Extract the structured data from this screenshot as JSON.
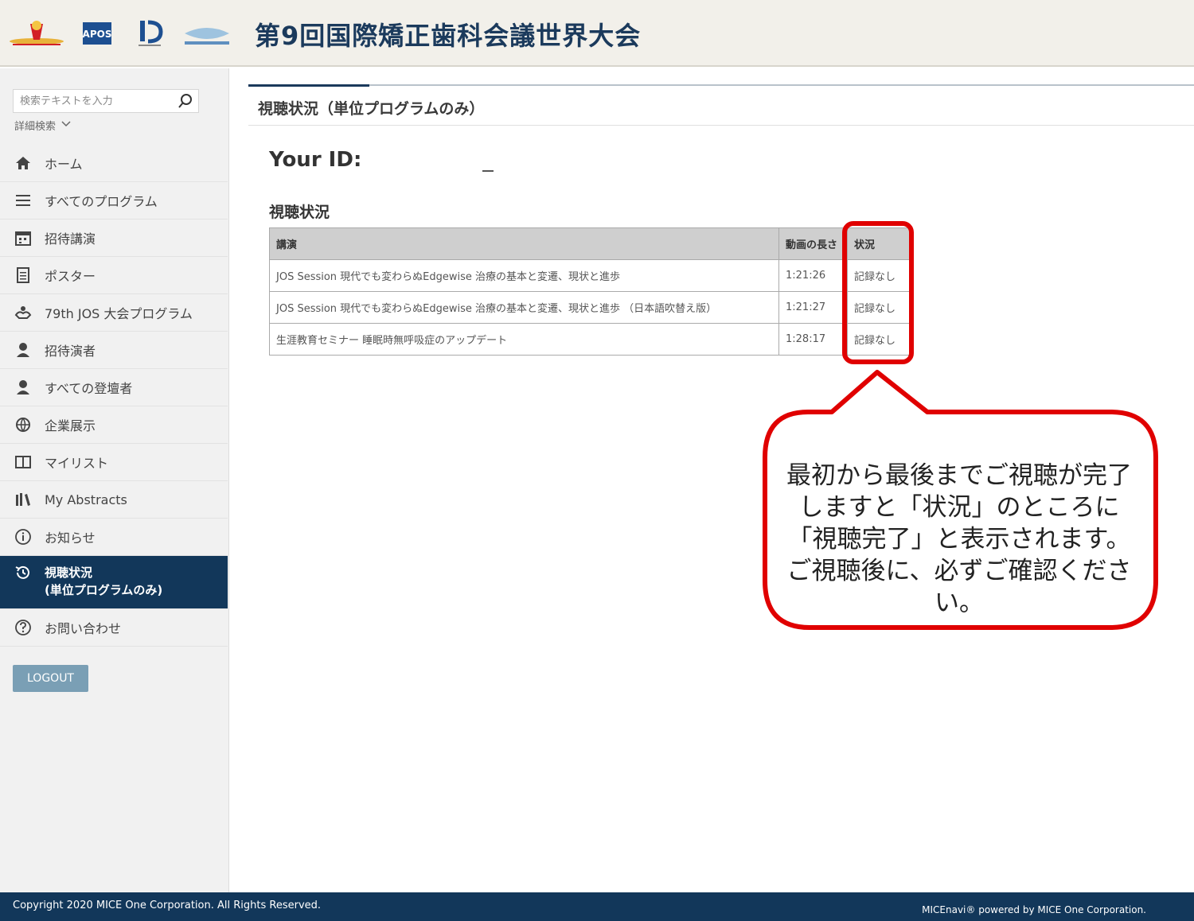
{
  "header": {
    "title": "第9回国際矯正歯科会議世界大会",
    "logos": [
      "congress-logo",
      "apos-logo",
      "ijo-logo",
      "wfo-logo"
    ]
  },
  "sidebar": {
    "search_placeholder": "検索テキストを入力",
    "advanced_search": "詳細検索",
    "items": [
      {
        "label": "ホーム",
        "icon": "home-icon"
      },
      {
        "label": "すべてのプログラム",
        "icon": "list-icon"
      },
      {
        "label": "招待講演",
        "icon": "calendar-icon"
      },
      {
        "label": "ポスター",
        "icon": "document-icon"
      },
      {
        "label": "79th JOS 大会プログラム",
        "icon": "hands-icon"
      },
      {
        "label": "招待演者",
        "icon": "person-icon"
      },
      {
        "label": "すべての登壇者",
        "icon": "person-icon"
      },
      {
        "label": "企業展示",
        "icon": "globe-icon"
      },
      {
        "label": "マイリスト",
        "icon": "book-icon"
      },
      {
        "label": "My Abstracts",
        "icon": "library-icon"
      },
      {
        "label": "お知らせ",
        "icon": "info-icon"
      },
      {
        "label": "視聴状況",
        "label2": "(単位プログラムのみ)",
        "icon": "history-icon",
        "active": true
      },
      {
        "label": "お問い合わせ",
        "icon": "help-icon"
      }
    ],
    "logout": "LOGOUT"
  },
  "main": {
    "page_title": "視聴状況（単位プログラムのみ）",
    "your_id_label": "Your ID:",
    "section_heading": "視聴状況",
    "table": {
      "headers": [
        "講演",
        "動画の長さ",
        "状況"
      ],
      "rows": [
        [
          "JOS Session 現代でも変わらぬEdgewise 治療の基本と変遷、現状と進歩",
          "1:21:26",
          "記録なし"
        ],
        [
          "JOS Session 現代でも変わらぬEdgewise 治療の基本と変遷、現状と進歩 （日本語吹替え版）",
          "1:21:27",
          "記録なし"
        ],
        [
          "生涯教育セミナー 睡眠時無呼吸症のアップデート",
          "1:28:17",
          "記録なし"
        ]
      ]
    }
  },
  "annotation": {
    "lines": [
      "最初から最後までご視聴が完了",
      "しますと「状況」のところに",
      "「視聴完了」と表示されます。",
      "ご視聴後に、必ずご確認ください。"
    ],
    "color": "#e00000"
  },
  "footer": {
    "copyright": "Copyright 2020 MICE One Corporation. All Rights Reserved.",
    "powered": "MICEnavi® powered by MICE One Corporation."
  },
  "colors": {
    "navy": "#12375a",
    "header_bg": "#f2f0ea",
    "sidebar_bg": "#f1f1f1",
    "logout_bg": "#7a9fb5"
  }
}
